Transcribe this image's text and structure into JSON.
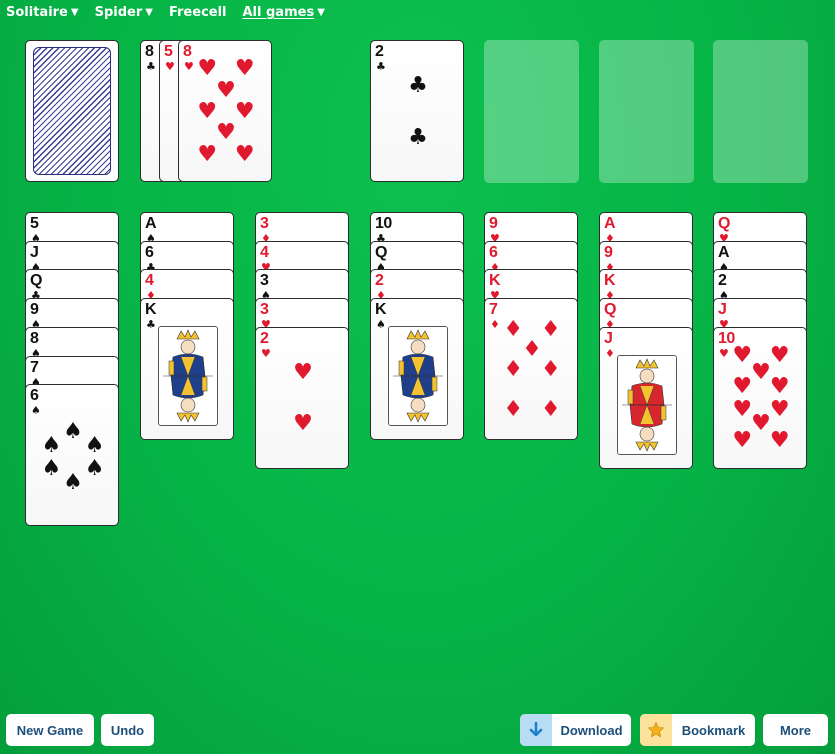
{
  "nav": [
    {
      "label": "Solitaire",
      "caret": true,
      "active": false
    },
    {
      "label": "Spider",
      "caret": true,
      "active": false
    },
    {
      "label": "Freecell",
      "caret": false,
      "active": false
    },
    {
      "label": "All games",
      "caret": true,
      "active": true
    }
  ],
  "stock": {
    "face_down": true
  },
  "waste": [
    {
      "rank": "8",
      "suit": "♣",
      "color": "black"
    },
    {
      "rank": "5",
      "suit": "♥",
      "color": "red"
    },
    {
      "rank": "8",
      "suit": "♥",
      "color": "red"
    }
  ],
  "foundations": [
    {
      "rank": "2",
      "suit": "♣",
      "color": "black"
    },
    null,
    null,
    null
  ],
  "tableau": [
    [
      {
        "rank": "5",
        "suit": "♠"
      },
      {
        "rank": "J",
        "suit": "♠"
      },
      {
        "rank": "Q",
        "suit": "♣"
      },
      {
        "rank": "9",
        "suit": "♠"
      },
      {
        "rank": "8",
        "suit": "♠"
      },
      {
        "rank": "7",
        "suit": "♠"
      },
      {
        "rank": "6",
        "suit": "♠"
      }
    ],
    [
      {
        "rank": "A",
        "suit": "♠"
      },
      {
        "rank": "6",
        "suit": "♣"
      },
      {
        "rank": "4",
        "suit": "♦"
      },
      {
        "rank": "K",
        "suit": "♣"
      }
    ],
    [
      {
        "rank": "3",
        "suit": "♦"
      },
      {
        "rank": "4",
        "suit": "♥"
      },
      {
        "rank": "3",
        "suit": "♠"
      },
      {
        "rank": "3",
        "suit": "♥"
      },
      {
        "rank": "2",
        "suit": "♥"
      }
    ],
    [
      {
        "rank": "10",
        "suit": "♣"
      },
      {
        "rank": "Q",
        "suit": "♠"
      },
      {
        "rank": "2",
        "suit": "♦"
      },
      {
        "rank": "K",
        "suit": "♠"
      }
    ],
    [
      {
        "rank": "9",
        "suit": "♥"
      },
      {
        "rank": "6",
        "suit": "♦"
      },
      {
        "rank": "K",
        "suit": "♥"
      },
      {
        "rank": "7",
        "suit": "♦"
      }
    ],
    [
      {
        "rank": "A",
        "suit": "♦"
      },
      {
        "rank": "9",
        "suit": "♦"
      },
      {
        "rank": "K",
        "suit": "♦"
      },
      {
        "rank": "Q",
        "suit": "♦"
      },
      {
        "rank": "J",
        "suit": "♦"
      }
    ],
    [
      {
        "rank": "Q",
        "suit": "♥"
      },
      {
        "rank": "A",
        "suit": "♠"
      },
      {
        "rank": "2",
        "suit": "♠"
      },
      {
        "rank": "J",
        "suit": "♥"
      },
      {
        "rank": "10",
        "suit": "♥"
      }
    ]
  ],
  "buttons": {
    "new_game": "New Game",
    "undo": "Undo",
    "download": "Download",
    "bookmark": "Bookmark",
    "more": "More"
  },
  "colors": {
    "felt": "#06b446",
    "red_suit": "#e0192f",
    "button_text": "#1c4f7a",
    "download_icon_bg": "#b9dcf5",
    "bookmark_icon_bg": "#fce29a"
  },
  "icons": {
    "download": "download-arrow-icon",
    "bookmark": "star-icon",
    "caret": "caret-down-icon"
  }
}
